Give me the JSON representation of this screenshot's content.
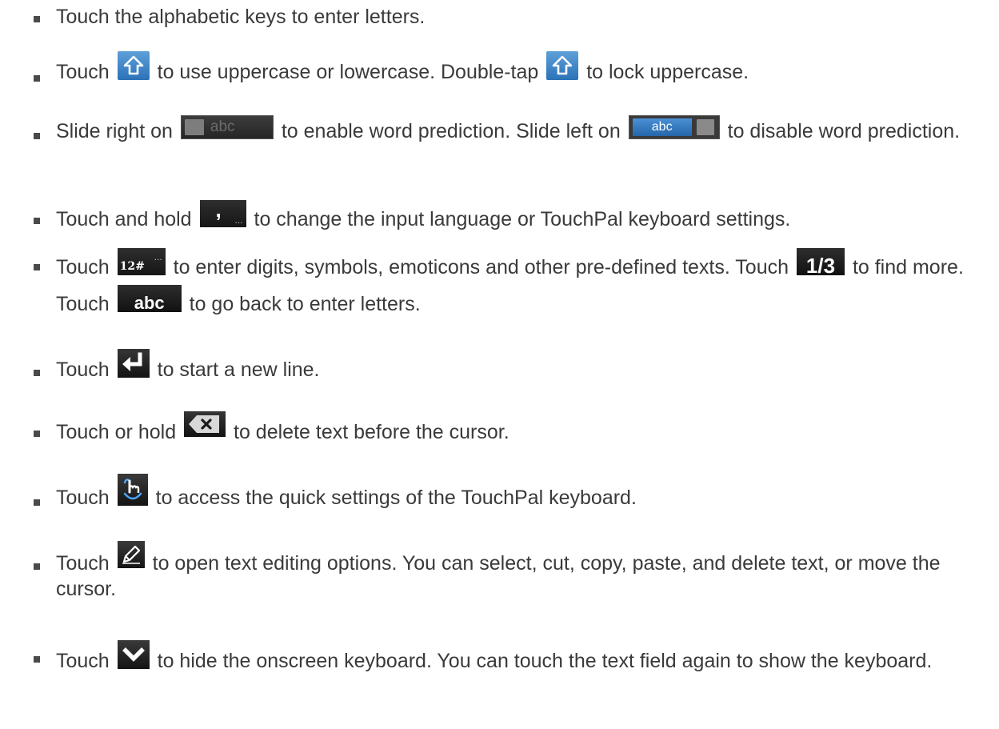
{
  "items": [
    {
      "segments": [
        "Touch the alphabetic keys to enter letters."
      ]
    },
    {
      "segments": [
        "Touch",
        "to use uppercase or lowercase. Double-tap",
        "to lock uppercase."
      ],
      "icons": [
        "shift-key-icon",
        "shift-key-icon"
      ]
    },
    {
      "segments": [
        "Slide right on",
        "to enable word prediction. Slide left on",
        "to disable word prediction."
      ],
      "icons": [
        "word-prediction-off-key-icon",
        "word-prediction-on-key-icon"
      ],
      "key_labels": {
        "prediction_off": "abc",
        "prediction_on": "abc"
      }
    },
    {
      "segments": [
        "Touch and hold",
        "to change the input language or TouchPal keyboard settings."
      ],
      "icons": [
        "comma-key-icon"
      ],
      "key_labels": {
        "comma": ",",
        "dots": "..."
      }
    },
    {
      "segments": [
        "Touch",
        "to enter digits, symbols, emoticons and other pre-defined texts. Touch",
        "to find more. Touch",
        "to go back to enter letters."
      ],
      "icons": [
        "symbols-key-icon",
        "page-key-icon",
        "abc-key-icon"
      ],
      "key_labels": {
        "symbols": "12#",
        "dots": "...",
        "page": "1/3",
        "abc": "abc"
      }
    },
    {
      "segments": [
        "Touch",
        "to start a new line."
      ],
      "icons": [
        "enter-key-icon"
      ]
    },
    {
      "segments": [
        "Touch or hold",
        "to delete text before the cursor."
      ],
      "icons": [
        "backspace-key-icon"
      ]
    },
    {
      "segments": [
        "Touch",
        "to access the quick settings of the TouchPal keyboard."
      ],
      "icons": [
        "gesture-settings-key-icon"
      ]
    },
    {
      "segments": [
        "Touch",
        "to open text editing options. You can select, cut, copy, paste, and delete text, or move the cursor."
      ],
      "icons": [
        "pencil-key-icon"
      ]
    },
    {
      "segments": [
        "Touch",
        "to hide the onscreen keyboard. You can touch the text field again to show the keyboard."
      ],
      "icons": [
        "hide-keyboard-key-icon"
      ]
    }
  ]
}
